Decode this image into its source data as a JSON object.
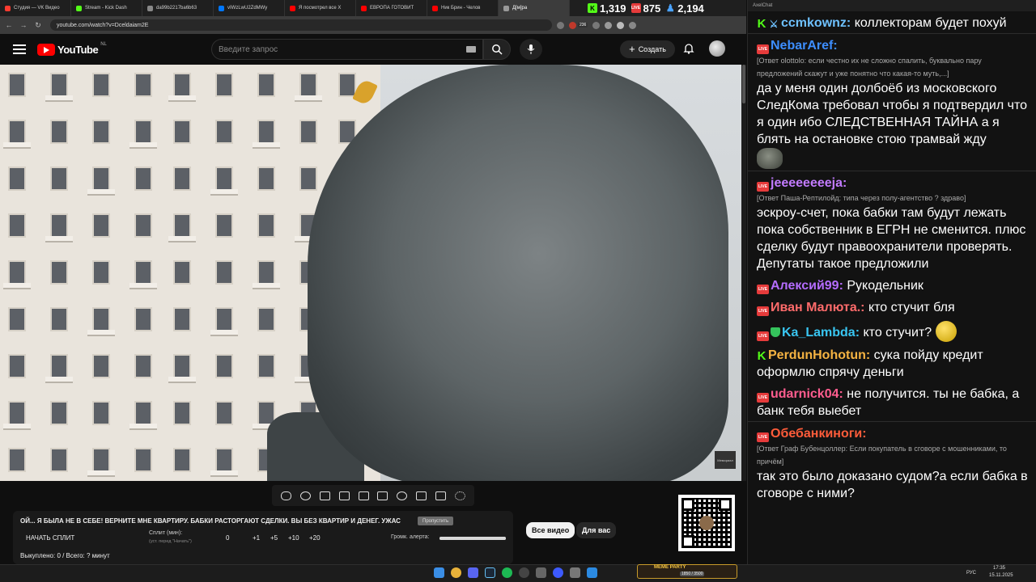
{
  "browser": {
    "tabs": [
      {
        "label": "Студия — VK Видео",
        "color": "#ff3b30"
      },
      {
        "label": "Stream - Kick Dash",
        "color": "#53fc18"
      },
      {
        "label": "da99b2217ba6b63",
        "color": "#888888"
      },
      {
        "label": "vIWzLwU2ZdMWy",
        "color": "#0077ff"
      },
      {
        "label": "Я посмотрел все Х",
        "color": "#ff0000"
      },
      {
        "label": "ЕВРОПА ГОТОВИТ",
        "color": "#ff0000"
      },
      {
        "label": "Ник Брин - Челов",
        "color": "#ff0000"
      },
      {
        "label": "Д[м]ра",
        "color": "#999999"
      }
    ],
    "url": "youtube.com/watch?v=Dceldaiam2E",
    "extension_badge": "236"
  },
  "counters": [
    {
      "platform": "kick-icon",
      "value": "1,319",
      "color": "#53fc18"
    },
    {
      "platform": "vk-live-icon",
      "value": "875",
      "color": "#e63b3b"
    },
    {
      "platform": "viewers-icon",
      "value": "2,194",
      "color": "#4aa3ff"
    }
  ],
  "youtube": {
    "logo_text": "YouTube",
    "region": "NL",
    "search_placeholder": "Введите запрос",
    "create_label": "Создать"
  },
  "video": {
    "watermark": "Мемориал"
  },
  "control_panel": {
    "marquee": "ОЙ... Я БЫЛА НЕ В СЕБЕ! ВЕРНИТЕ МНЕ КВАРТИРУ. БАБКИ РАСТОРГАЮТ СДЕЛКИ. ВЫ БЕЗ КВАРТИР И ДЕНЕГ. УЖАС",
    "tag_button": "Пропустить",
    "split_button": "НАЧАТЬ СПЛИТ",
    "split_label": "Сплит (мин):",
    "split_hint": "(уст. перед \"Начать\")",
    "split_values": [
      "0",
      "+1",
      "+5",
      "+10",
      "+20"
    ],
    "volume_label": "Громк. алерта:",
    "volume_level": 1.0,
    "done_text": "Выкуплено: 0 / Всего: ? минут"
  },
  "filters": {
    "all_videos": "Все видео",
    "for_you": "Для вас"
  },
  "chat": {
    "window_title": "AxelChat",
    "messages": [
      {
        "badges": [
          "kick",
          "sword"
        ],
        "user": "ccmkownz:",
        "color": "#6ec1ff",
        "text": "коллекторам будет похуй"
      },
      {
        "badges": [
          "live"
        ],
        "user": "NebarAref:",
        "color": "#3d8eff",
        "reply": "[Ответ olottolo: если честно их не сложно спалить, буквально пару предложений скажут и уже понятно что какая-то муть,...]",
        "text": "да у меня один долбоёб из московского СледКома требовал чтобы я подтвердил что я один ибо СЛЕДСТВЕННАЯ ТАЙНА а я блять на остановке стою трамвай жду"
      },
      {
        "badges": [
          "live"
        ],
        "user": "jeeeeeeeeja:",
        "color": "#c27bff",
        "reply": "[Ответ Паша-Рептилойд: типа через полу-агентство ? здраво]",
        "text": "эскроу-счет, пока бабки там будут лежать пока собственник в ЕГРН не сменится. плюс сделку будут правоохранители проверять. Депутаты такое предложили"
      },
      {
        "badges": [
          "live"
        ],
        "user": "Алексий99:",
        "color": "#b56cff",
        "text": "Рукодельник"
      },
      {
        "badges": [
          "live"
        ],
        "user": "Иван Малюта.:",
        "color": "#ff6b6b",
        "text": "кто стучит бля"
      },
      {
        "badges": [
          "live",
          "shield"
        ],
        "user": "Ka_Lambda:",
        "color": "#39c6f2",
        "text": "кто стучит?"
      },
      {
        "badges": [
          "kick"
        ],
        "user": "PerdunHohotun:",
        "color": "#f5b342",
        "text": "сука пойду кредит оформлю спрячу деньги"
      },
      {
        "badges": [
          "live"
        ],
        "user": "udarnick04:",
        "color": "#ff5d8f",
        "text": "не получится. ты не бабка, а банк тебя выебет"
      },
      {
        "badges": [
          "live"
        ],
        "user": "Обебанкиноги:",
        "color": "#ff5c3a",
        "reply": "[Ответ Граф Бубенцоллер: Если покупатель в сговоре с мошенниками, то причём]",
        "text": "так это было доказано судом?а если бабка в сговоре с ними?"
      }
    ]
  },
  "taskbar": {
    "widget_label": "MEME PARTY",
    "widget_progress": "1850 / 3500",
    "lang": "РУС",
    "time": "17:35",
    "date": "15.11.2025"
  }
}
